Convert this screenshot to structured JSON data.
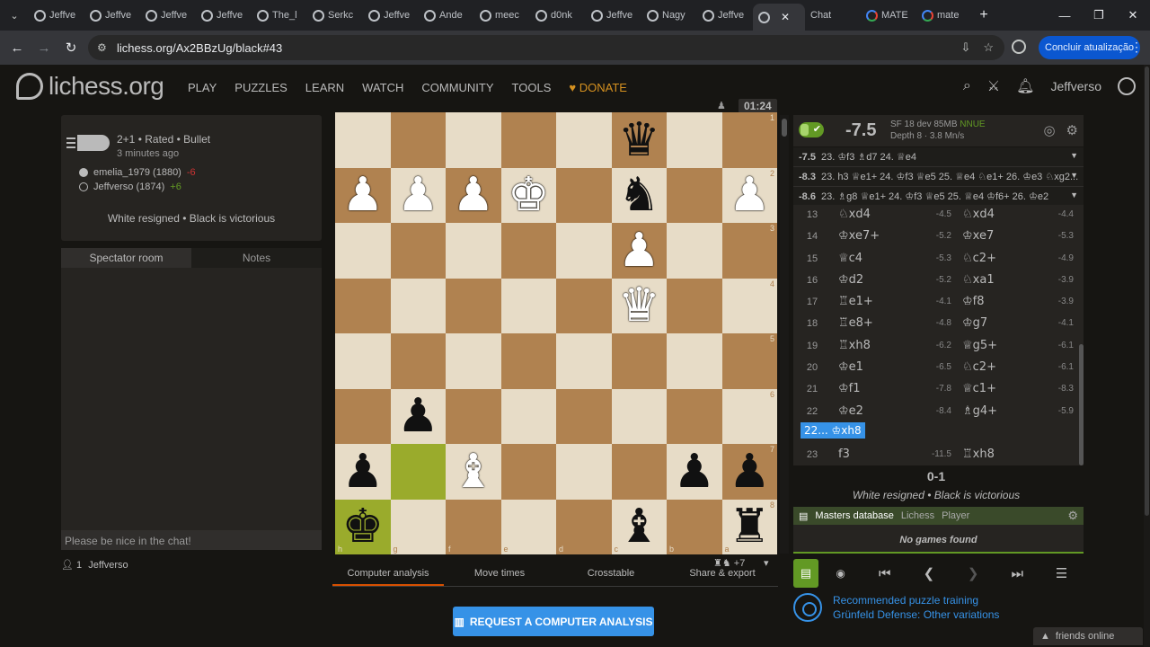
{
  "browser": {
    "tabs": [
      {
        "title": "Jeffve",
        "fav": "lichess"
      },
      {
        "title": "Jeffve",
        "fav": "lichess"
      },
      {
        "title": "Jeffve",
        "fav": "lichess"
      },
      {
        "title": "Jeffve",
        "fav": "lichess"
      },
      {
        "title": "The_l",
        "fav": "lichess"
      },
      {
        "title": "Serkc",
        "fav": "lichess"
      },
      {
        "title": "Jeffve",
        "fav": "lichess"
      },
      {
        "title": "Ande",
        "fav": "lichess"
      },
      {
        "title": "meec",
        "fav": "lichess"
      },
      {
        "title": "d0nk",
        "fav": "lichess"
      },
      {
        "title": "Jeffve",
        "fav": "lichess"
      },
      {
        "title": "Nagy",
        "fav": "lichess"
      },
      {
        "title": "Jeffve",
        "fav": "lichess"
      }
    ],
    "tabs_after": [
      {
        "title": "Chat",
        "fav": "chat"
      },
      {
        "title": "MATE",
        "fav": "g"
      },
      {
        "title": "mate",
        "fav": "g"
      }
    ],
    "url": "lichess.org/Ax2BBzUg/black#43",
    "update_label": "Concluir atualização"
  },
  "site": {
    "logo": "lichess.org",
    "nav": [
      "PLAY",
      "PUZZLES",
      "LEARN",
      "WATCH",
      "COMMUNITY",
      "TOOLS"
    ],
    "donate": "DONATE",
    "username": "Jeffverso"
  },
  "game": {
    "title": "2+1 • Rated • Bullet",
    "time_ago": "3 minutes ago",
    "white_player": "emelia_1979 (1880)",
    "white_diff": "-6",
    "black_player": "Jeffverso (1874)",
    "black_diff": "+6",
    "result": "White resigned • Black is victorious"
  },
  "chat": {
    "tab_room": "Spectator room",
    "tab_notes": "Notes",
    "placeholder": "Please be nice in the chat!",
    "spectator_count": "1",
    "spectator_name": "Jeffverso"
  },
  "board": {
    "clock_top": "01:24",
    "foot": "+7",
    "ranks": [
      [
        "",
        "",
        "",
        "",
        "",
        "bq",
        "",
        ""
      ],
      [
        "wp",
        "wp",
        "wp",
        "wk",
        "",
        "bn",
        "",
        "wp"
      ],
      [
        "",
        "",
        "",
        "",
        "",
        "wp",
        "",
        ""
      ],
      [
        "",
        "",
        "",
        "",
        "",
        "wq",
        "",
        ""
      ],
      [
        "",
        "",
        "",
        "",
        "",
        "",
        "",
        ""
      ],
      [
        "",
        "bp",
        "",
        "",
        "",
        "",
        "",
        ""
      ],
      [
        "bp",
        "",
        "wb",
        "",
        "",
        "",
        "bp",
        "bp"
      ],
      [
        "bk",
        "",
        "",
        "",
        "",
        "bb",
        "",
        "br"
      ]
    ],
    "rank_labels": [
      "1",
      "2",
      "3",
      "4",
      "5",
      "6",
      "7",
      "8"
    ],
    "file_labels": [
      "h",
      "g",
      "f",
      "e",
      "d",
      "c",
      "b",
      "a"
    ]
  },
  "under_tabs": [
    "Computer analysis",
    "Move times",
    "Crosstable",
    "Share & export"
  ],
  "request_button": "REQUEST A COMPUTER ANALYSIS",
  "ceval": {
    "eval": "-7.5",
    "engine": "SF 18 dev 85MB",
    "nnue": "NNUE",
    "depth": "Depth 8 · 3.8 Mn/s",
    "pvs": [
      {
        "score": "-7.5",
        "line": "23. ♔f3 ♗d7 24. ♕e4"
      },
      {
        "score": "-8.3",
        "line": "23. h3 ♕e1+ 24. ♔f3 ♕e5 25. ♕e4 ♘e1+ 26. ♔e3 ♘xg2..."
      },
      {
        "score": "-8.6",
        "line": "23. ♗g8 ♕e1+ 24. ♔f3 ♕e5 25. ♕e4 ♔f6+ 26. ♔e2"
      }
    ]
  },
  "moves": [
    {
      "n": "13",
      "w": "♘xd4",
      "we": "-4.5",
      "b": "♘xd4",
      "be": "-4.4"
    },
    {
      "n": "14",
      "w": "♔xe7+",
      "we": "-5.2",
      "b": "♔xe7",
      "be": "-5.3"
    },
    {
      "n": "15",
      "w": "♕c4",
      "we": "-5.3",
      "b": "♘c2+",
      "be": "-4.9"
    },
    {
      "n": "16",
      "w": "♔d2",
      "we": "-5.2",
      "b": "♘xa1",
      "be": "-3.9"
    },
    {
      "n": "17",
      "w": "♖e1+",
      "we": "-4.1",
      "b": "♔f8",
      "be": "-3.9"
    },
    {
      "n": "18",
      "w": "♖e8+",
      "we": "-4.8",
      "b": "♔g7",
      "be": "-4.1"
    },
    {
      "n": "19",
      "w": "♖xh8",
      "we": "-6.2",
      "b": "♕g5+",
      "be": "-6.1"
    },
    {
      "n": "20",
      "w": "♔e1",
      "we": "-6.5",
      "b": "♘c2+",
      "be": "-6.1"
    },
    {
      "n": "21",
      "w": "♔f1",
      "we": "-7.8",
      "b": "♕c1+",
      "be": "-8.3"
    },
    {
      "n": "22",
      "w": "♔e2",
      "we": "-8.4",
      "b": "♗g4+",
      "be": "-5.9"
    }
  ],
  "current_move": "22... ♔xh8",
  "last_row": {
    "n": "23",
    "w": "f3",
    "we": "-11.5",
    "b": "♖xh8",
    "be": ""
  },
  "result_score": "0-1",
  "result_text": "White resigned • Black is victorious",
  "explorer": {
    "db": "Masters database",
    "opt1": "Lichess",
    "opt2": "Player",
    "empty": "No games found"
  },
  "puzzle": {
    "line1": "Recommended puzzle training",
    "line2": "Grünfeld Defense: Other variations"
  },
  "friends": "friends online"
}
